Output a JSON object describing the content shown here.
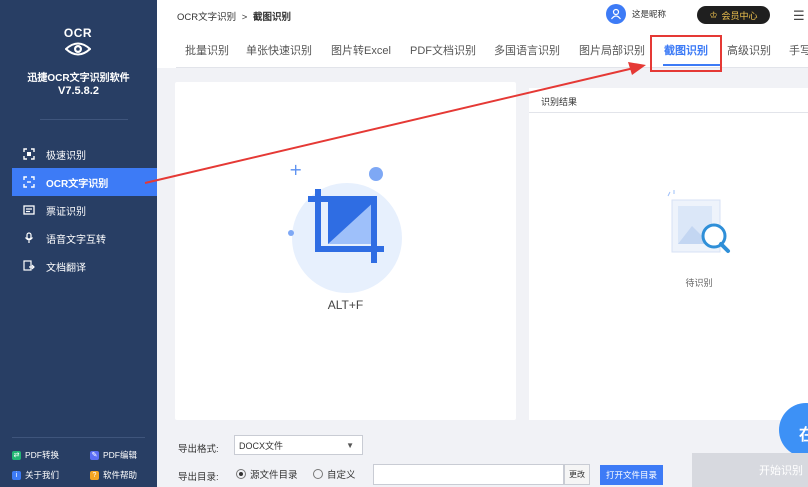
{
  "app": {
    "logo_text": "OCR",
    "name": "迅捷OCR文字识别软件",
    "version": "V7.5.8.2"
  },
  "sidebar": {
    "items": [
      {
        "label": "极速识别",
        "icon": "quick-scan-icon",
        "active": false
      },
      {
        "label": "OCR文字识别",
        "icon": "ocr-frame-icon",
        "active": true
      },
      {
        "label": "票证识别",
        "icon": "ticket-icon",
        "active": false
      },
      {
        "label": "语音文字互转",
        "icon": "microphone-icon",
        "active": false
      },
      {
        "label": "文档翻译",
        "icon": "translate-icon",
        "active": false
      }
    ],
    "bottom_links": [
      {
        "label": "PDF转换",
        "color": "#22b573"
      },
      {
        "label": "PDF编辑",
        "color": "#5b6ef5"
      },
      {
        "label": "关于我们",
        "color": "#3d7bf6"
      },
      {
        "label": "软件帮助",
        "color": "#f5a623"
      }
    ]
  },
  "header": {
    "breadcrumb_parent": "OCR文字识别",
    "breadcrumb_sep": ">",
    "breadcrumb_current": "截图识别",
    "username": "这是昵称",
    "vip_label": "会员中心"
  },
  "tabs": [
    {
      "label": "批量识别",
      "active": false
    },
    {
      "label": "单张快速识别",
      "active": false
    },
    {
      "label": "图片转Excel",
      "active": false
    },
    {
      "label": "PDF文档识别",
      "active": false
    },
    {
      "label": "多国语言识别",
      "active": false
    },
    {
      "label": "图片局部识别",
      "active": false
    },
    {
      "label": "截图识别",
      "active": true
    },
    {
      "label": "高级识别",
      "active": false
    },
    {
      "label": "手写",
      "active": false
    }
  ],
  "capture_panel": {
    "shortcut": "ALT+F"
  },
  "result_panel": {
    "header": "识别结果",
    "status": "待识别"
  },
  "float_button_label": "在",
  "footer": {
    "format_label": "导出格式:",
    "format_value": "DOCX文件",
    "dir_label": "导出目录:",
    "radio_source": "源文件目录",
    "radio_custom": "自定义",
    "path_value": "",
    "change_label": "更改",
    "open_dir_label": "打开文件目录",
    "start_label": "开始识别"
  },
  "colors": {
    "sidebar_bg": "#283e64",
    "accent": "#3d7bf6",
    "annotation": "#e53935"
  }
}
